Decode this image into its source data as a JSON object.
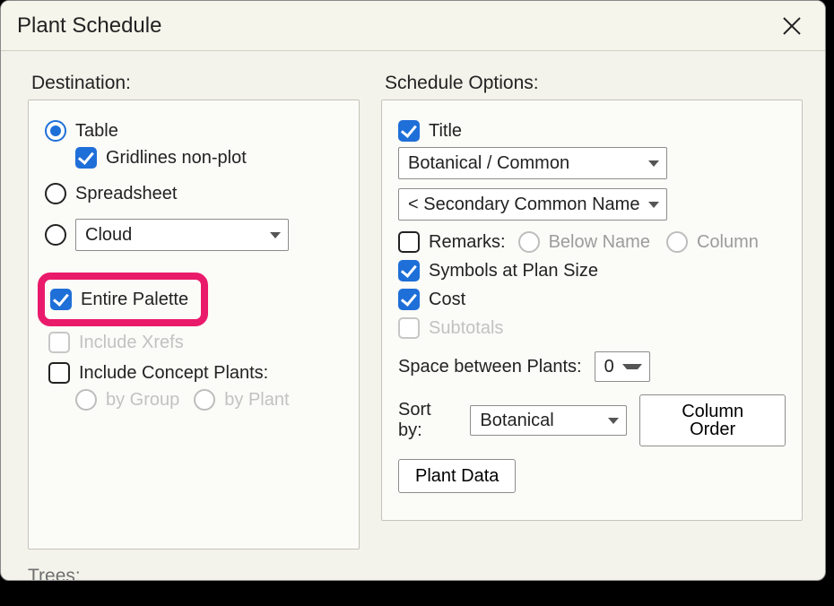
{
  "dialog": {
    "title": "Plant Schedule"
  },
  "destination": {
    "label": "Destination:",
    "table": "Table",
    "gridlines": "Gridlines non-plot",
    "spreadsheet": "Spreadsheet",
    "cloud_option": "Cloud",
    "entire_palette": "Entire Palette",
    "include_xrefs": "Include Xrefs",
    "include_concept": "Include Concept Plants:",
    "by_group": "by Group",
    "by_plant": "by Plant"
  },
  "options": {
    "label": "Schedule Options:",
    "title": "Title",
    "name_mode": "Botanical / Common",
    "secondary": "< Secondary Common Name",
    "remarks": "Remarks:",
    "below_name": "Below Name",
    "column": "Column",
    "symbols": "Symbols at Plan Size",
    "cost": "Cost",
    "subtotals": "Subtotals",
    "space_label": "Space between Plants:",
    "space_value": "0",
    "sort_label": "Sort by:",
    "sort_value": "Botanical",
    "column_order_btn": "Column Order",
    "plant_data_btn": "Plant Data"
  },
  "trees": {
    "label": "Trees:"
  }
}
